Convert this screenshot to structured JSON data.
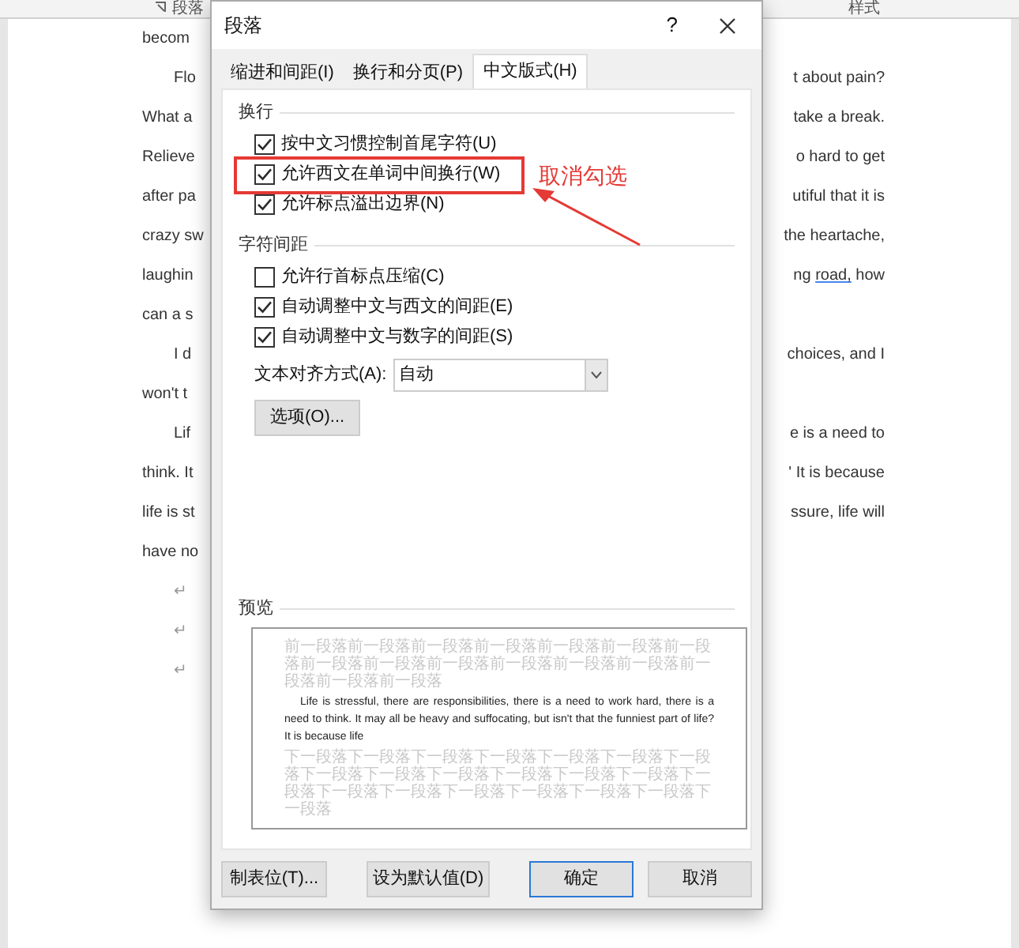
{
  "ribbon": {
    "group_label": "段落",
    "styles_label": "样式"
  },
  "document": {
    "lines": [
      {
        "left": "becom",
        "indent": false
      },
      {
        "left": "Flo",
        "indent": true,
        "right": [
          {
            "text": "t about pain?",
            "underlined": false
          }
        ]
      },
      {
        "left": "What a",
        "indent": false,
        "right": [
          {
            "text": "take a break.",
            "underlined": false
          }
        ]
      },
      {
        "left": "Relieve",
        "indent": false,
        "right": [
          {
            "text": "o hard to get",
            "underlined": false
          }
        ]
      },
      {
        "left": "after pa",
        "indent": false,
        "right": [
          {
            "text": "utiful that it is",
            "underlined": false
          }
        ]
      },
      {
        "left": "crazy sw",
        "indent": false,
        "right": [
          {
            "text": "the heartache,",
            "underlined": false
          }
        ]
      },
      {
        "left": "laughin",
        "indent": false,
        "right": [
          {
            "text": "ng ",
            "underlined": false
          },
          {
            "text": "road,",
            "underlined": true
          },
          {
            "text": " how",
            "underlined": false
          }
        ]
      },
      {
        "left": "can a s",
        "indent": false
      },
      {
        "left": "I d",
        "indent": true,
        "right": [
          {
            "text": "choices, and I",
            "underlined": false
          }
        ]
      },
      {
        "left": "won't t",
        "indent": false
      },
      {
        "left": "Lif",
        "indent": true,
        "right": [
          {
            "text": "e is a need to",
            "underlined": false
          }
        ]
      },
      {
        "left": "think. It",
        "indent": false,
        "right": [
          {
            "text": "' It is because",
            "underlined": false
          }
        ]
      },
      {
        "left": "life is st",
        "indent": false,
        "right": [
          {
            "text": "ssure, life will",
            "underlined": false
          }
        ]
      },
      {
        "left": "have no",
        "indent": false
      },
      {
        "left": "↵",
        "indent": true
      },
      {
        "left": "↵",
        "indent": true
      },
      {
        "left": "↵",
        "indent": true
      }
    ]
  },
  "dialog": {
    "title": "段落",
    "help": "?",
    "tabs": [
      {
        "label": "缩进和间距(I)",
        "selected": false
      },
      {
        "label": "换行和分页(P)",
        "selected": false
      },
      {
        "label": "中文版式(H)",
        "selected": true
      }
    ],
    "sections": [
      {
        "title": "换行",
        "items": [
          {
            "label": "按中文习惯控制首尾字符(U)",
            "checked": true,
            "annotated": false
          },
          {
            "label": "允许西文在单词中间换行(W)",
            "checked": true,
            "annotated": true
          },
          {
            "label": "允许标点溢出边界(N)",
            "checked": true,
            "annotated": false
          }
        ]
      },
      {
        "title": "字符间距",
        "items": [
          {
            "label": "允许行首标点压缩(C)",
            "checked": false,
            "annotated": false
          },
          {
            "label": "自动调整中文与西文的间距(E)",
            "checked": true,
            "annotated": false
          },
          {
            "label": "自动调整中文与数字的间距(S)",
            "checked": true,
            "annotated": false
          }
        ]
      }
    ],
    "alignment": {
      "label": "文本对齐方式(A):",
      "value": "自动"
    },
    "options_button": "选项(O)...",
    "preview": {
      "title": "预览",
      "previous_text": "前一段落前一段落前一段落前一段落前一段落前一段落前一段落前一段落前一段落前一段落前一段落前一段落前一段落前一段落前一段落前一段落",
      "sample_text": "Life is stressful, there are responsibilities, there is a need to work hard, there is a need to think. It may all be heavy and suffocating, but isn't that the funniest part of life? It is because life",
      "next_text": "下一段落下一段落下一段落下一段落下一段落下一段落下一段落下一段落下一段落下一段落下一段落下一段落下一段落下一段落下一段落下一段落下一段落下一段落下一段落下一段落下一段落"
    },
    "buttons": [
      {
        "label": "制表位(T)...",
        "default": false
      },
      {
        "label": "设为默认值(D)",
        "default": false
      },
      {
        "label": "确定",
        "default": true
      },
      {
        "label": "取消",
        "default": false
      }
    ]
  },
  "annotation": {
    "text": "取消勾选"
  }
}
